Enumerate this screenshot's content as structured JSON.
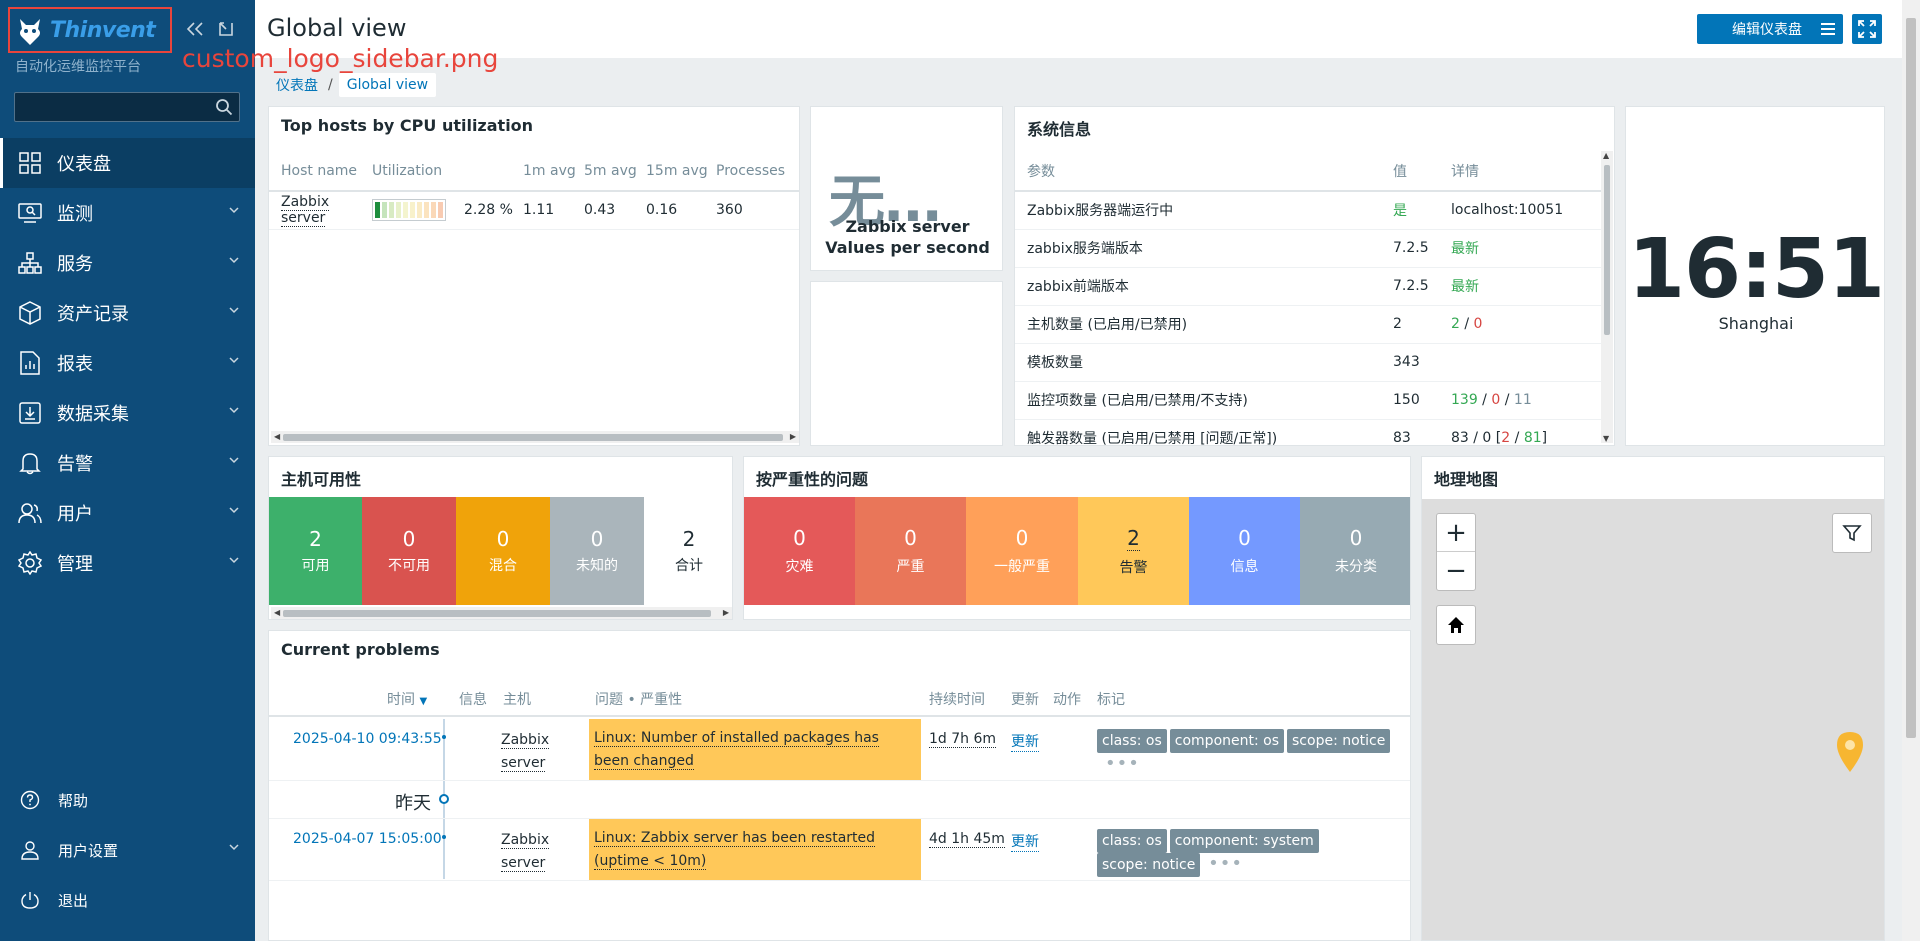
{
  "sidebar": {
    "logo_text": "Thinvent",
    "logo_file_note": "custom_logo_sidebar.png",
    "subtitle": "自动化运维监控平台",
    "search_placeholder": "",
    "menu": [
      {
        "label": "仪表盘",
        "icon": "dashboard-icon",
        "active": true
      },
      {
        "label": "监测",
        "icon": "monitoring-icon"
      },
      {
        "label": "服务",
        "icon": "services-icon"
      },
      {
        "label": "资产记录",
        "icon": "inventory-icon"
      },
      {
        "label": "报表",
        "icon": "reports-icon"
      },
      {
        "label": "数据采集",
        "icon": "data-collection-icon"
      },
      {
        "label": "告警",
        "icon": "alerts-icon"
      },
      {
        "label": "用户",
        "icon": "users-icon"
      },
      {
        "label": "管理",
        "icon": "administration-icon"
      }
    ],
    "bottom": [
      {
        "label": "帮助",
        "icon": "help-icon"
      },
      {
        "label": "用户设置",
        "icon": "user-settings-icon"
      },
      {
        "label": "退出",
        "icon": "signout-icon"
      }
    ]
  },
  "header": {
    "title": "Global view",
    "edit_button": "编辑仪表盘"
  },
  "breadcrumb": {
    "root": "仪表盘",
    "sep": "/",
    "current": "Global view"
  },
  "top_hosts": {
    "title": "Top hosts by CPU utilization",
    "columns": [
      "Host name",
      "Utilization",
      "1m avg",
      "5m avg",
      "15m avg",
      "Processes"
    ],
    "rows": [
      {
        "host": "Zabbix server",
        "utilization": 2.28,
        "util_text": "2.28 %",
        "m1": "1.11",
        "m5": "0.43",
        "m15": "0.16",
        "processes": "360"
      }
    ]
  },
  "item_value": {
    "value": "无...",
    "line1": "Zabbix server",
    "line2": "Values per second"
  },
  "system_info": {
    "title": "系统信息",
    "columns": [
      "参数",
      "值",
      "详情"
    ],
    "rows": [
      {
        "param": "Zabbix服务器端运行中",
        "value": "是",
        "value_color": "green",
        "details": "localhost:10051"
      },
      {
        "param": "zabbix服务端版本",
        "value": "7.2.5",
        "details_green": "最新"
      },
      {
        "param": "zabbix前端版本",
        "value": "7.2.5",
        "details_green": "最新"
      },
      {
        "param": "主机数量 (已启用/已禁用)",
        "value": "2",
        "d1": "2",
        "d2": "0"
      },
      {
        "param": "模板数量",
        "value": "343"
      },
      {
        "param": "监控项数量 (已启用/已禁用/不支持)",
        "value": "150",
        "d1": "139",
        "d2": "0",
        "d3": "11"
      },
      {
        "param": "触发器数量 (已启用/已禁用 [问题/正常])",
        "value": "83",
        "d_prefix": "83 / 0 [",
        "d2": "2",
        "d_mid": " / ",
        "d1": "81",
        "d_suffix": "]"
      }
    ]
  },
  "clock": {
    "time": "16:51",
    "zone": "Shanghai"
  },
  "host_availability": {
    "title": "主机可用性",
    "cells": [
      {
        "num": "2",
        "label": "可用",
        "color": "#3db06b"
      },
      {
        "num": "0",
        "label": "不可用",
        "color": "#d9534f"
      },
      {
        "num": "0",
        "label": "混合",
        "color": "#f0a30a"
      },
      {
        "num": "0",
        "label": "未知的",
        "color": "#aab5bb"
      },
      {
        "num": "2",
        "label": "合计",
        "color": "#ffffff"
      }
    ]
  },
  "problems_by_severity": {
    "title": "按严重性的问题",
    "cells": [
      {
        "num": "0",
        "label": "灾难",
        "color": "#e45959"
      },
      {
        "num": "0",
        "label": "严重",
        "color": "#e97659"
      },
      {
        "num": "0",
        "label": "一般严重",
        "color": "#ffa059"
      },
      {
        "num": "2",
        "label": "告警",
        "color": "#ffc859"
      },
      {
        "num": "0",
        "label": "信息",
        "color": "#7499ff"
      },
      {
        "num": "0",
        "label": "未分类",
        "color": "#97aab3"
      }
    ]
  },
  "geomap": {
    "title": "地理地图",
    "zoom_in": "+",
    "zoom_out": "−"
  },
  "current_problems": {
    "title": "Current problems",
    "columns": {
      "time": "时间",
      "info": "信息",
      "host": "主机",
      "problem": "问题 • 严重性",
      "duration": "持续时间",
      "update": "更新",
      "actions": "动作",
      "tags": "标记"
    },
    "yesterday": "昨天",
    "rows": [
      {
        "time": "2025-04-10 09:43:55",
        "host1": "Zabbix",
        "host2": "server",
        "problem": "Linux: Number of installed packages has been changed",
        "duration": "1d 7h 6m",
        "update": "更新",
        "tags": [
          "class: os",
          "component: os",
          "scope: notice"
        ]
      },
      {
        "time": "2025-04-07 15:05:00",
        "host1": "Zabbix",
        "host2": "server",
        "problem": "Linux: Zabbix server has been restarted (uptime < 10m)",
        "duration": "4d 1h 45m",
        "update": "更新",
        "tags": [
          "class: os",
          "component: system",
          "scope: notice"
        ]
      }
    ]
  }
}
